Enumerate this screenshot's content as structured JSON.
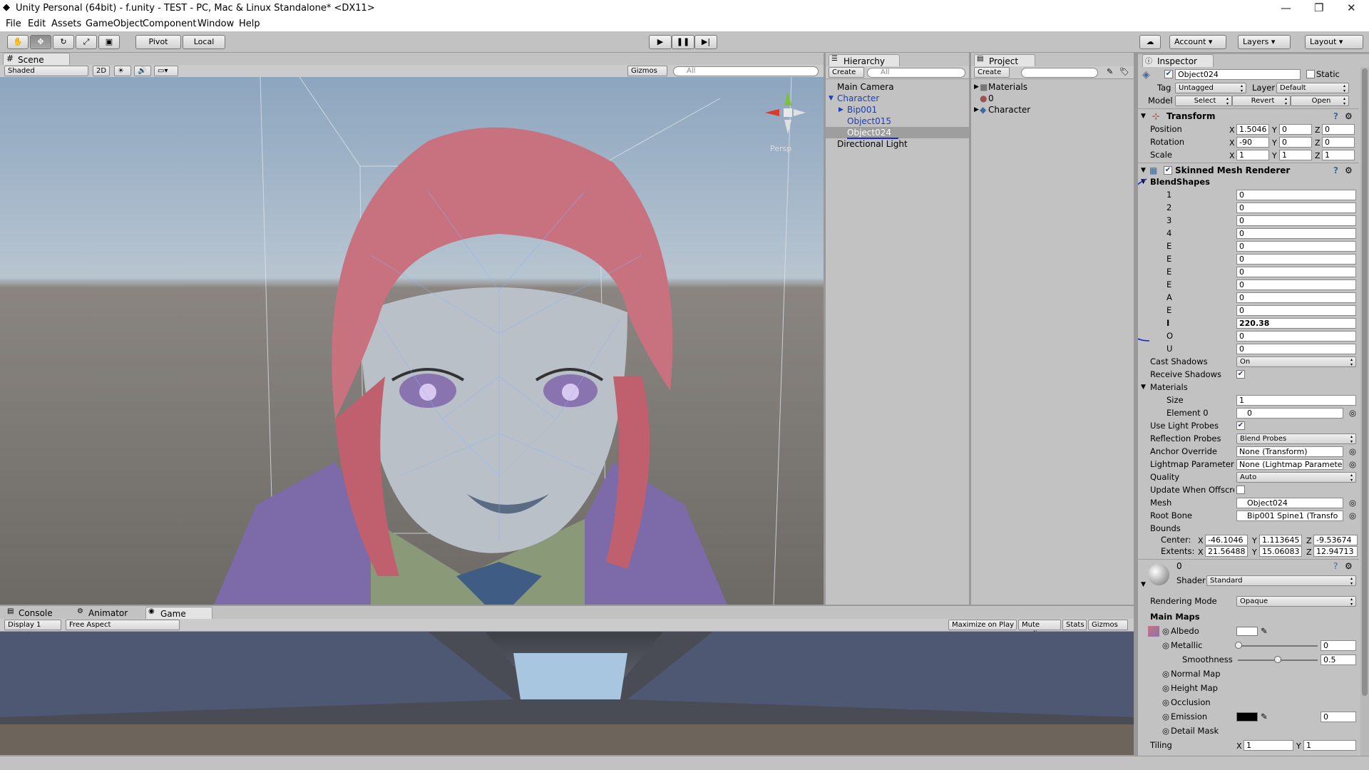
{
  "window": {
    "title": "Unity Personal (64bit) - f.unity - TEST - PC, Mac & Linux Standalone* <DX11>"
  },
  "menu": [
    "File",
    "Edit",
    "Assets",
    "GameObject",
    "Component",
    "Window",
    "Help"
  ],
  "toolbar": {
    "pivot": "Pivot",
    "local": "Local",
    "account": "Account",
    "layers": "Layers",
    "layout": "Layout"
  },
  "scene": {
    "tab": "Scene",
    "shading": "Shaded",
    "mode2d": "2D",
    "gizmos": "Gizmos",
    "search": "All",
    "persp": "Persp"
  },
  "hierarchy": {
    "tab": "Hierarchy",
    "create": "Create",
    "search": "All",
    "items": [
      "Main Camera",
      "Character",
      "Bip001",
      "Object015",
      "Object024",
      "Directional Light"
    ]
  },
  "project": {
    "tab": "Project",
    "create": "Create",
    "items": [
      "Materials",
      "0",
      "Character"
    ]
  },
  "inspector": {
    "tab": "Inspector",
    "object_name": "Object024",
    "static": "Static",
    "tag_label": "Tag",
    "tag_value": "Untagged",
    "layer_label": "Layer",
    "layer_value": "Default",
    "model_label": "Model",
    "select": "Select",
    "revert": "Revert",
    "open": "Open",
    "transform": {
      "title": "Transform",
      "position": {
        "label": "Position",
        "x": "1.5046",
        "y": "0",
        "z": "0"
      },
      "rotation": {
        "label": "Rotation",
        "x": "-90",
        "y": "0",
        "z": "0"
      },
      "scale": {
        "label": "Scale",
        "x": "1",
        "y": "1",
        "z": "1"
      }
    },
    "smr": {
      "title": "Skinned Mesh Renderer",
      "blendshapes_label": "BlendShapes",
      "blendshapes": [
        {
          "name": "1",
          "value": "0"
        },
        {
          "name": "2",
          "value": "0"
        },
        {
          "name": "3",
          "value": "0"
        },
        {
          "name": "4",
          "value": "0"
        },
        {
          "name": "E",
          "value": "0"
        },
        {
          "name": "E",
          "value": "0"
        },
        {
          "name": "E",
          "value": "0"
        },
        {
          "name": "E",
          "value": "0"
        },
        {
          "name": "A",
          "value": "0"
        },
        {
          "name": "E",
          "value": "0"
        },
        {
          "name": "I",
          "value": "220.38"
        },
        {
          "name": "O",
          "value": "0"
        },
        {
          "name": "U",
          "value": "0"
        }
      ],
      "cast_shadows_label": "Cast Shadows",
      "cast_shadows": "On",
      "receive_shadows_label": "Receive Shadows",
      "materials_label": "Materials",
      "size_label": "Size",
      "size": "1",
      "element0_label": "Element 0",
      "element0": "0",
      "use_light_probes_label": "Use Light Probes",
      "reflection_probes_label": "Reflection Probes",
      "reflection_probes": "Blend Probes",
      "anchor_override_label": "Anchor Override",
      "anchor_override": "None (Transform)",
      "lightmap_param_label": "Lightmap Parameter",
      "lightmap_param": "None (Lightmap Paramete",
      "quality_label": "Quality",
      "quality": "Auto",
      "update_offscreen_label": "Update When Offscre",
      "mesh_label": "Mesh",
      "mesh": "Object024",
      "root_bone_label": "Root Bone",
      "root_bone": "Bip001 Spine1 (Transfo",
      "bounds_label": "Bounds",
      "center": {
        "label": "Center:",
        "x": "-46.1046",
        "y": "1.113645",
        "z": "-9.53674"
      },
      "extents": {
        "label": "Extents:",
        "x": "21.56488",
        "y": "15.06083",
        "z": "12.94713"
      }
    },
    "material": {
      "name": "0",
      "shader_label": "Shader",
      "shader": "Standard",
      "rendering_mode_label": "Rendering Mode",
      "rendering_mode": "Opaque",
      "main_maps": "Main Maps",
      "albedo": "Albedo",
      "metallic": "Metallic",
      "metallic_value": "0",
      "smoothness": "Smoothness",
      "smoothness_value": "0.5",
      "normal_map": "Normal Map",
      "height_map": "Height Map",
      "occlusion": "Occlusion",
      "emission": "Emission",
      "emission_value": "0",
      "detail_mask": "Detail Mask",
      "tiling": "Tiling",
      "tiling_x": "1",
      "tiling_y": "1"
    }
  },
  "bottom_tabs": {
    "console": "Console",
    "animator": "Animator",
    "game": "Game"
  },
  "game": {
    "display": "Display 1",
    "aspect": "Free Aspect",
    "maximize": "Maximize on Play",
    "mute": "Mute audio",
    "stats": "Stats",
    "gizmos": "Gizmos"
  },
  "colors": {
    "accent_blue": "#1a3fb8",
    "selection": "#b0b0b0",
    "annotation": "#0000ff"
  }
}
